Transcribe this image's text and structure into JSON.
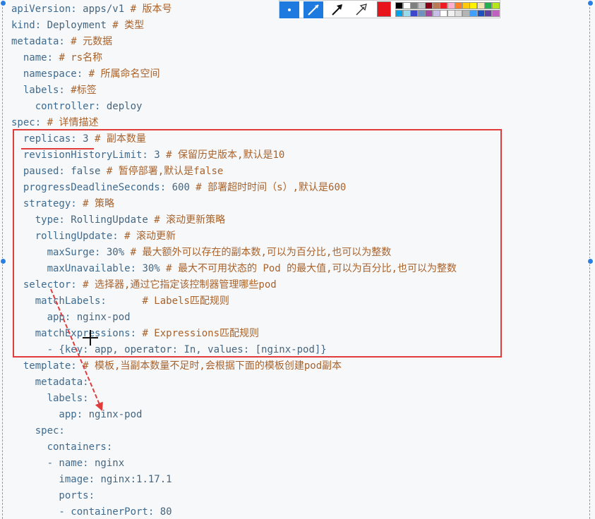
{
  "editor": {
    "lines": [
      {
        "key": "apiVersion:",
        "value": " apps/v1",
        "comment": " # 版本号"
      },
      {
        "key": "kind:",
        "value": " Deployment",
        "comment": " # 类型"
      },
      {
        "key": "metadata:",
        "value": "",
        "comment": " # 元数据"
      },
      {
        "key": "  name:",
        "value": "",
        "comment": " # rs名称"
      },
      {
        "key": "  namespace:",
        "value": "",
        "comment": " # 所属命名空间"
      },
      {
        "key": "  labels:",
        "value": "",
        "comment": " #标签"
      },
      {
        "key": "    controller:",
        "value": " deploy",
        "comment": ""
      },
      {
        "key": "spec:",
        "value": "",
        "comment": " # 详情描述"
      },
      {
        "key": "  replicas:",
        "value": " 3",
        "comment": " # 副本数量"
      },
      {
        "key": "  revisionHistoryLimit:",
        "value": " 3",
        "comment": " # 保留历史版本,默认是10"
      },
      {
        "key": "  paused:",
        "value": " false",
        "comment": " # 暂停部署,默认是false"
      },
      {
        "key": "  progressDeadlineSeconds:",
        "value": " 600",
        "comment": " # 部署超时时间（s）,默认是600"
      },
      {
        "key": "  strategy:",
        "value": "",
        "comment": " # 策略"
      },
      {
        "key": "    type:",
        "value": " RollingUpdate",
        "comment": " # 滚动更新策略"
      },
      {
        "key": "    rollingUpdate:",
        "value": "",
        "comment": " # 滚动更新"
      },
      {
        "key": "      maxSurge:",
        "value": " 30%",
        "comment": " # 最大额外可以存在的副本数,可以为百分比,也可以为整数"
      },
      {
        "key": "      maxUnavailable:",
        "value": " 30%",
        "comment": " # 最大不可用状态的 Pod 的最大值,可以为百分比,也可以为整数"
      },
      {
        "key": "  selector:",
        "value": "",
        "comment": " # 选择器,通过它指定该控制器管理哪些pod"
      },
      {
        "key": "    matchLabels:",
        "value": "      ",
        "comment": "# Labels匹配规则"
      },
      {
        "key": "      app:",
        "value": " nginx-pod",
        "comment": ""
      },
      {
        "key": "    matchExpressions:",
        "value": "",
        "comment": " # Expressions匹配规则"
      },
      {
        "key": "      - {key:",
        "value": " app, operator: In, values: [nginx-pod]}",
        "comment": ""
      },
      {
        "key": "  template:",
        "value": "",
        "comment": " # 模板,当副本数量不足时,会根据下面的模板创建pod副本"
      },
      {
        "key": "    metadata:",
        "value": "",
        "comment": ""
      },
      {
        "key": "      labels:",
        "value": "",
        "comment": ""
      },
      {
        "key": "        app:",
        "value": " nginx-pod",
        "comment": ""
      },
      {
        "key": "    spec:",
        "value": "",
        "comment": ""
      },
      {
        "key": "      containers:",
        "value": "",
        "comment": ""
      },
      {
        "key": "      - name:",
        "value": " nginx",
        "comment": ""
      },
      {
        "key": "        image:",
        "value": " nginx:1.17.1",
        "comment": ""
      },
      {
        "key": "        ports:",
        "value": "",
        "comment": ""
      },
      {
        "key": "        - containerPort:",
        "value": " 80",
        "comment": ""
      }
    ]
  },
  "toolbar": {
    "tools": [
      {
        "name": "select-tool",
        "icon": "dot-icon"
      },
      {
        "name": "pen-tool",
        "icon": "pen-icon"
      },
      {
        "name": "arrow-tool",
        "icon": "arrow-icon"
      },
      {
        "name": "hollow-arrow-tool",
        "icon": "hollow-arrow-icon"
      }
    ],
    "current_color": "#e8141c",
    "palette_row1": [
      "#000000",
      "#ffffff",
      "#7f7f7f",
      "#c3c3c3",
      "#880015",
      "#b97a57",
      "#ed1c24",
      "#ffaec9",
      "#ff7f27",
      "#ffc90e",
      "#fff200",
      "#efe4b0",
      "#22b14c",
      "#b5e61d"
    ],
    "palette_row2": [
      "#00a2e8",
      "#99d9ea",
      "#3f48cc",
      "#7092be",
      "#a349a4",
      "#c8bfe7",
      "#ffffff",
      "#f0f0f0",
      "#dcdcdc",
      "#b4b4b4",
      "#3fa0ff",
      "#2050c0",
      "#6040a0",
      "#c060c0"
    ]
  },
  "annotations": {
    "color": "#e23b3b"
  }
}
